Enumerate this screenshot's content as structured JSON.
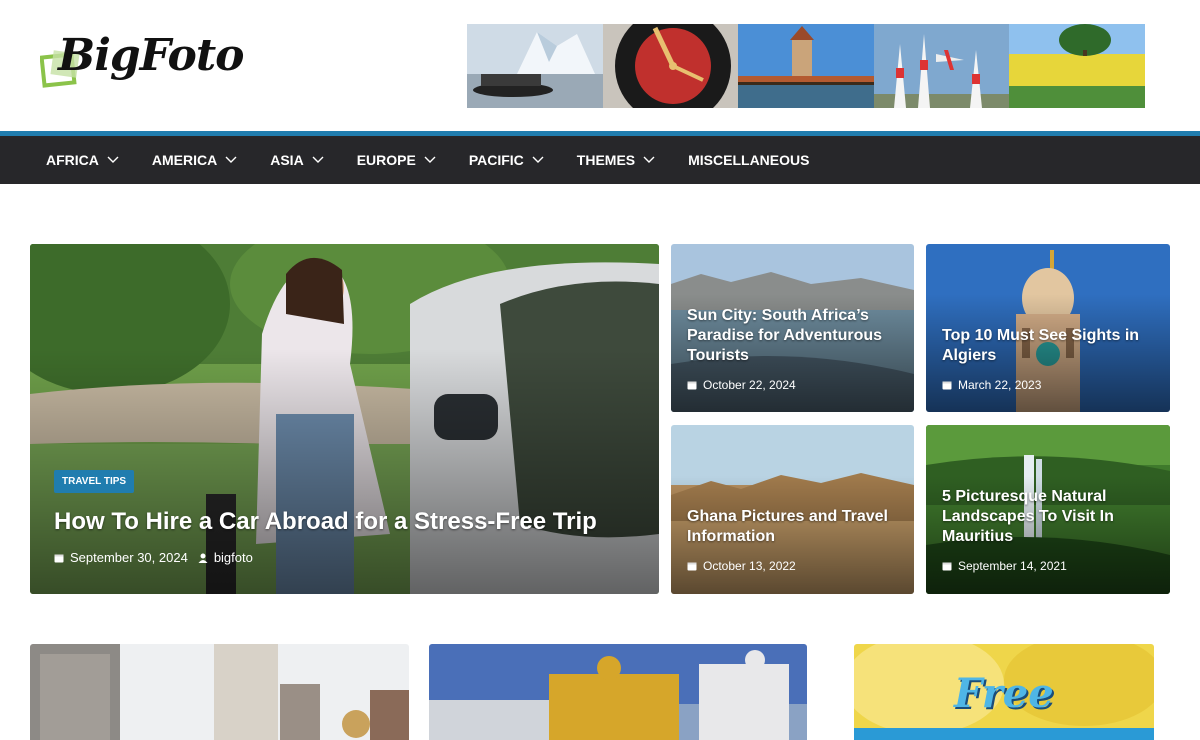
{
  "site": {
    "logo_text": "BigFoto",
    "accent_color": "#207daf",
    "nav_bg": "#27272a"
  },
  "banner": {
    "tiles": [
      "iceberg-boat",
      "clock-face",
      "lake-tower-bridge",
      "air-race-pylons",
      "rapeseed-field-tree"
    ]
  },
  "nav": {
    "items": [
      {
        "label": "AFRICA",
        "has_dropdown": true
      },
      {
        "label": "AMERICA",
        "has_dropdown": true
      },
      {
        "label": "ASIA",
        "has_dropdown": true
      },
      {
        "label": "EUROPE",
        "has_dropdown": true
      },
      {
        "label": "PACIFIC",
        "has_dropdown": true
      },
      {
        "label": "THEMES",
        "has_dropdown": true
      },
      {
        "label": "MISCELLANEOUS",
        "has_dropdown": false
      }
    ]
  },
  "featured": {
    "main": {
      "category": "TRAVEL TIPS",
      "title": "How To Hire a Car Abroad for a Stress-Free Trip",
      "date": "September 30, 2024",
      "author": "bigfoto"
    },
    "cards": [
      {
        "title": "Sun City: South Africa’s Paradise for Adventurous Tourists",
        "date": "October 22, 2024"
      },
      {
        "title": "Top 10 Must See Sights in Algiers",
        "date": "March 22, 2023"
      },
      {
        "title": "Ghana Pictures and Travel Information",
        "date": "October 13, 2022"
      },
      {
        "title": "5 Picturesque Natural Landscapes To Visit In Mauritius",
        "date": "September 14, 2021"
      }
    ]
  },
  "sidebar": {
    "ad_text": "Free"
  }
}
